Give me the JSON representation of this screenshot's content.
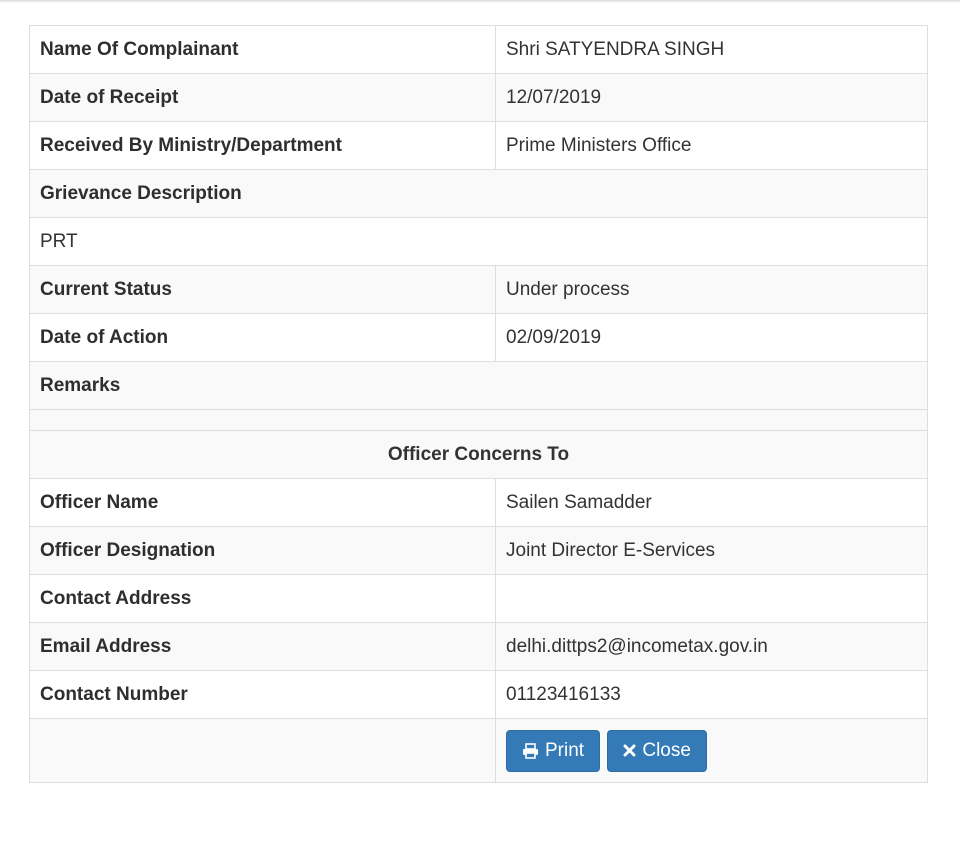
{
  "grievance": {
    "rows": [
      {
        "label": "Name Of Complainant",
        "value": "Shri SATYENDRA SINGH"
      },
      {
        "label": "Date of Receipt",
        "value": "12/07/2019"
      },
      {
        "label": "Received By Ministry/Department",
        "value": "Prime Ministers Office"
      }
    ],
    "description_label": "Grievance Description",
    "description_value": "PRT",
    "status_rows": [
      {
        "label": "Current Status",
        "value": "Under process"
      },
      {
        "label": "Date of Action",
        "value": "02/09/2019"
      }
    ],
    "remarks_label": "Remarks"
  },
  "officer": {
    "section_title": "Officer Concerns To",
    "rows": [
      {
        "label": "Officer Name",
        "value": "Sailen Samadder"
      },
      {
        "label": "Officer Designation",
        "value": "Joint Director E-Services"
      },
      {
        "label": "Contact Address",
        "value": ""
      },
      {
        "label": "Email Address",
        "value": "delhi.dittps2@incometax.gov.in"
      },
      {
        "label": "Contact Number",
        "value": "01123416133"
      }
    ]
  },
  "actions": {
    "print_label": "Print",
    "close_label": "Close",
    "print_icon": "print-icon",
    "close_icon": "close-icon",
    "button_color": "#337ab7"
  }
}
